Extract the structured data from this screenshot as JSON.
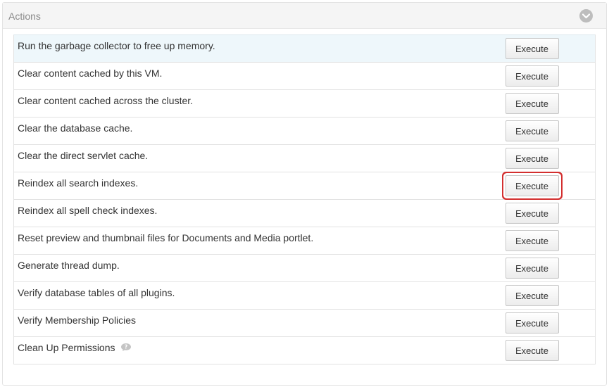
{
  "panel": {
    "title": "Actions",
    "toggle_icon": "chevron-down-circle-icon"
  },
  "actions": [
    {
      "label": "Run the garbage collector to free up memory.",
      "button": "Execute"
    },
    {
      "label": "Clear content cached by this VM.",
      "button": "Execute"
    },
    {
      "label": "Clear content cached across the cluster.",
      "button": "Execute"
    },
    {
      "label": "Clear the database cache.",
      "button": "Execute"
    },
    {
      "label": "Clear the direct servlet cache.",
      "button": "Execute"
    },
    {
      "label": "Reindex all search indexes.",
      "button": "Execute",
      "highlighted": true
    },
    {
      "label": "Reindex all spell check indexes.",
      "button": "Execute"
    },
    {
      "label": "Reset preview and thumbnail files for Documents and Media portlet.",
      "button": "Execute"
    },
    {
      "label": "Generate thread dump.",
      "button": "Execute"
    },
    {
      "label": "Verify database tables of all plugins.",
      "button": "Execute"
    },
    {
      "label": "Verify Membership Policies",
      "button": "Execute"
    },
    {
      "label": "Clean Up Permissions",
      "button": "Execute",
      "help_icon": "question-bubble-icon"
    }
  ],
  "colors": {
    "highlight_border": "#d32f2f",
    "first_row_bg": "#eef7fb"
  }
}
